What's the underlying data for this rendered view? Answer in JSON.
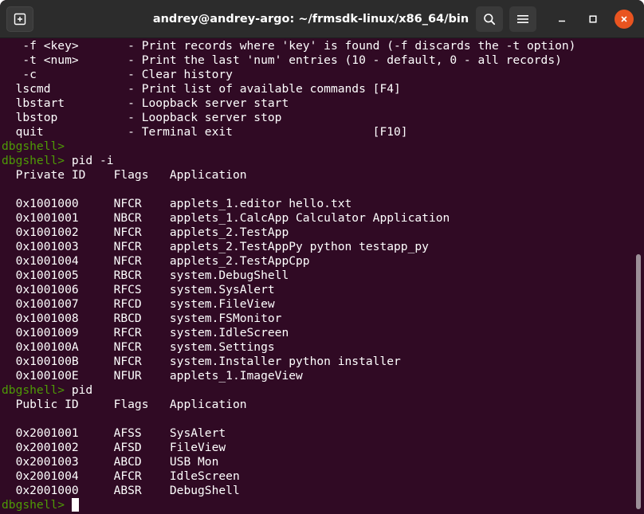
{
  "window": {
    "title": "andrey@andrey-argo: ~/frmsdk-linux/x86_64/bin"
  },
  "icons": {
    "new_tab": "new-tab-icon",
    "search": "search-icon",
    "menu": "hamburger-menu-icon",
    "minimize": "minimize-icon",
    "maximize": "maximize-icon",
    "close": "close-icon"
  },
  "colors": {
    "terminal_bg": "#300a24",
    "prompt": "#4e9a06",
    "text": "#ffffff",
    "close_button": "#e95420",
    "titlebar": "#2c2c2c"
  },
  "terminal": {
    "prompt": "dbgshell>",
    "lines": [
      {
        "text": "   -f <key>       - Print records where 'key' is found (-f discards the -t option)"
      },
      {
        "text": "   -t <num>       - Print the last 'num' entries (10 - default, 0 - all records)"
      },
      {
        "text": "   -c             - Clear history"
      },
      {
        "text": "  lscmd           - Print list of available commands [F4]"
      },
      {
        "text": "  lbstart         - Loopback server start"
      },
      {
        "text": "  lbstop          - Loopback server stop"
      },
      {
        "text": "  quit            - Terminal exit                    [F10]"
      },
      {
        "prompt": "dbgshell>",
        "text": ""
      },
      {
        "prompt": "dbgshell>",
        "text": " pid -i"
      },
      {
        "text": "  Private ID    Flags   Application"
      },
      {
        "text": ""
      },
      {
        "text": "  0x1001000     NFCR    applets_1.editor hello.txt"
      },
      {
        "text": "  0x1001001     NBCR    applets_1.CalcApp Calculator Application"
      },
      {
        "text": "  0x1001002     NFCR    applets_2.TestApp"
      },
      {
        "text": "  0x1001003     NFCR    applets_2.TestAppPy python testapp_py"
      },
      {
        "text": "  0x1001004     NFCR    applets_2.TestAppCpp"
      },
      {
        "text": "  0x1001005     RBCR    system.DebugShell"
      },
      {
        "text": "  0x1001006     RFCS    system.SysAlert"
      },
      {
        "text": "  0x1001007     RFCD    system.FileView"
      },
      {
        "text": "  0x1001008     RBCD    system.FSMonitor"
      },
      {
        "text": "  0x1001009     RFCR    system.IdleScreen"
      },
      {
        "text": "  0x100100A     NFCR    system.Settings"
      },
      {
        "text": "  0x100100B     NFCR    system.Installer python installer"
      },
      {
        "text": "  0x100100E     NFUR    applets_1.ImageView"
      },
      {
        "prompt": "dbgshell>",
        "text": " pid"
      },
      {
        "text": "  Public ID     Flags   Application"
      },
      {
        "text": ""
      },
      {
        "text": "  0x2001001     AFSS    SysAlert"
      },
      {
        "text": "  0x2001002     AFSD    FileView"
      },
      {
        "text": "  0x2001003     ABCD    USB Mon"
      },
      {
        "text": "  0x2001004     AFCR    IdleScreen"
      },
      {
        "text": "  0x2001000     ABSR    DebugShell"
      },
      {
        "prompt": "dbgshell>",
        "text": " ",
        "cursor": true
      }
    ]
  }
}
